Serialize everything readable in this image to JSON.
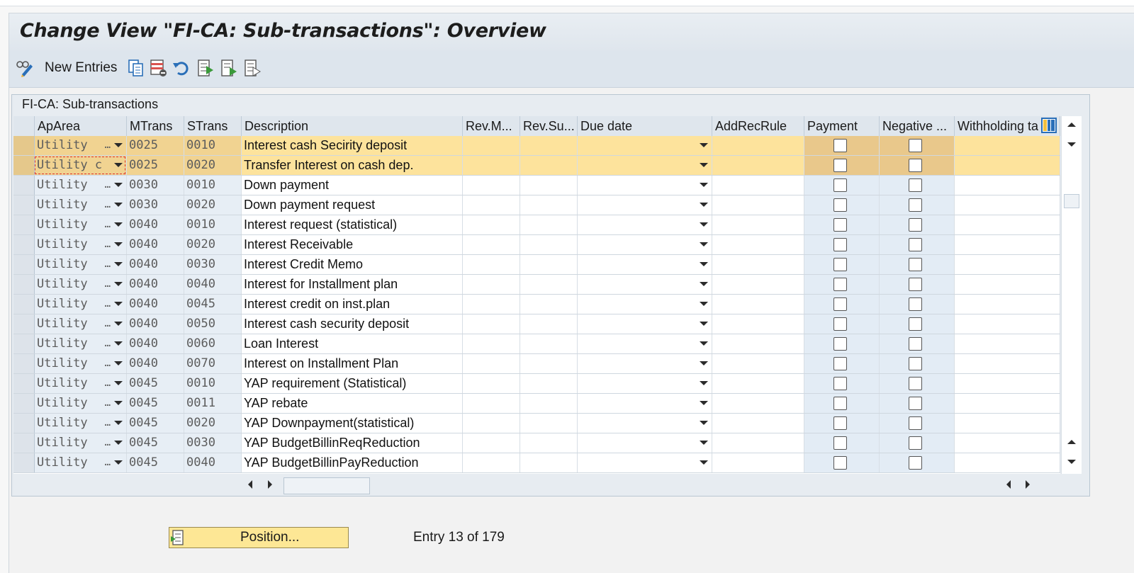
{
  "window": {
    "title": "Change View \"FI-CA: Sub-transactions\": Overview"
  },
  "toolbar": {
    "new_entries_label": "New Entries",
    "icons": [
      "display-change-icon",
      "copy-as-icon",
      "delete-icon",
      "undo-icon",
      "select-all-icon",
      "select-block-icon",
      "deselect-all-icon"
    ]
  },
  "panel": {
    "title": "FI-CA: Sub-transactions"
  },
  "table": {
    "columns": [
      "ApArea",
      "MTrans",
      "STrans",
      "Description",
      "Rev.M...",
      "Rev.Su...",
      "Due date",
      "AddRecRule",
      "Payment",
      "Negative ...",
      "Withholding ta"
    ],
    "rows": [
      {
        "aparea": "Utility",
        "mtrans": "0025",
        "strans": "0010",
        "description": "Interest cash Secirity deposit",
        "selected": true
      },
      {
        "aparea": "Utility c",
        "mtrans": "0025",
        "strans": "0020",
        "description": "Transfer Interest on cash dep.",
        "selected": true,
        "focused": true
      },
      {
        "aparea": "Utility",
        "mtrans": "0030",
        "strans": "0010",
        "description": "Down payment"
      },
      {
        "aparea": "Utility",
        "mtrans": "0030",
        "strans": "0020",
        "description": "Down payment request"
      },
      {
        "aparea": "Utility",
        "mtrans": "0040",
        "strans": "0010",
        "description": "Interest request (statistical)"
      },
      {
        "aparea": "Utility",
        "mtrans": "0040",
        "strans": "0020",
        "description": "Interest Receivable"
      },
      {
        "aparea": "Utility",
        "mtrans": "0040",
        "strans": "0030",
        "description": "Interest Credit Memo"
      },
      {
        "aparea": "Utility",
        "mtrans": "0040",
        "strans": "0040",
        "description": "Interest for Installment  plan"
      },
      {
        "aparea": "Utility",
        "mtrans": "0040",
        "strans": "0045",
        "description": "Interest credit on inst.plan"
      },
      {
        "aparea": "Utility",
        "mtrans": "0040",
        "strans": "0050",
        "description": "Interest cash security deposit"
      },
      {
        "aparea": "Utility",
        "mtrans": "0040",
        "strans": "0060",
        "description": "Loan Interest"
      },
      {
        "aparea": "Utility",
        "mtrans": "0040",
        "strans": "0070",
        "description": "Interest on Installment Plan"
      },
      {
        "aparea": "Utility",
        "mtrans": "0045",
        "strans": "0010",
        "description": "YAP requirement (Statistical)"
      },
      {
        "aparea": "Utility",
        "mtrans": "0045",
        "strans": "0011",
        "description": "YAP rebate"
      },
      {
        "aparea": "Utility",
        "mtrans": "0045",
        "strans": "0020",
        "description": "YAP Downpayment(statistical)"
      },
      {
        "aparea": "Utility",
        "mtrans": "0045",
        "strans": "0030",
        "description": "YAP BudgetBillinReqReduction"
      },
      {
        "aparea": "Utility",
        "mtrans": "0045",
        "strans": "0040",
        "description": "YAP BudgetBillinPayReduction"
      }
    ]
  },
  "footer": {
    "position_label": "Position...",
    "entry_text": "Entry 13 of 179"
  },
  "colors": {
    "selected_row": "#fde39c",
    "title_bar": "#dfe6ed",
    "position_button": "#fde795"
  }
}
